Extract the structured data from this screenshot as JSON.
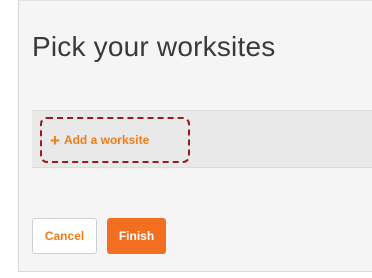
{
  "dialog": {
    "title": "Pick your worksites",
    "add_worksite": {
      "icon": "plus-icon",
      "icon_glyph": "+",
      "label": "Add a worksite"
    },
    "buttons": {
      "cancel_label": "Cancel",
      "finish_label": "Finish"
    }
  },
  "colors": {
    "accent": "#f07c1a",
    "primary_button": "#f26f21",
    "highlight_outline": "#9b1b1b"
  }
}
